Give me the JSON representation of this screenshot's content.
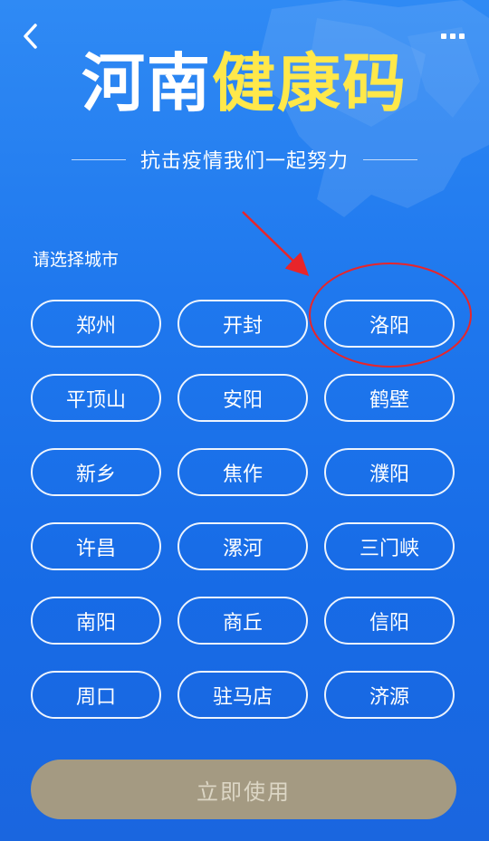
{
  "header": {
    "title_part1": "河南",
    "title_part2": "健康码",
    "subtitle": "抗击疫情我们一起努力"
  },
  "city_picker": {
    "prompt": "请选择城市",
    "cities": [
      "郑州",
      "开封",
      "洛阳",
      "平顶山",
      "安阳",
      "鹤壁",
      "新乡",
      "焦作",
      "濮阳",
      "许昌",
      "漯河",
      "三门峡",
      "南阳",
      "商丘",
      "信阳",
      "周口",
      "驻马店",
      "济源"
    ],
    "highlighted_city": "洛阳"
  },
  "footer": {
    "confirm_label": "立即使用"
  },
  "icons": {
    "back": "back-chevron-icon",
    "more": "more-dots-icon"
  },
  "colors": {
    "accent_yellow": "#ffe84a",
    "confirm_bg": "#a49a82",
    "annotation_red": "#e8252a"
  }
}
